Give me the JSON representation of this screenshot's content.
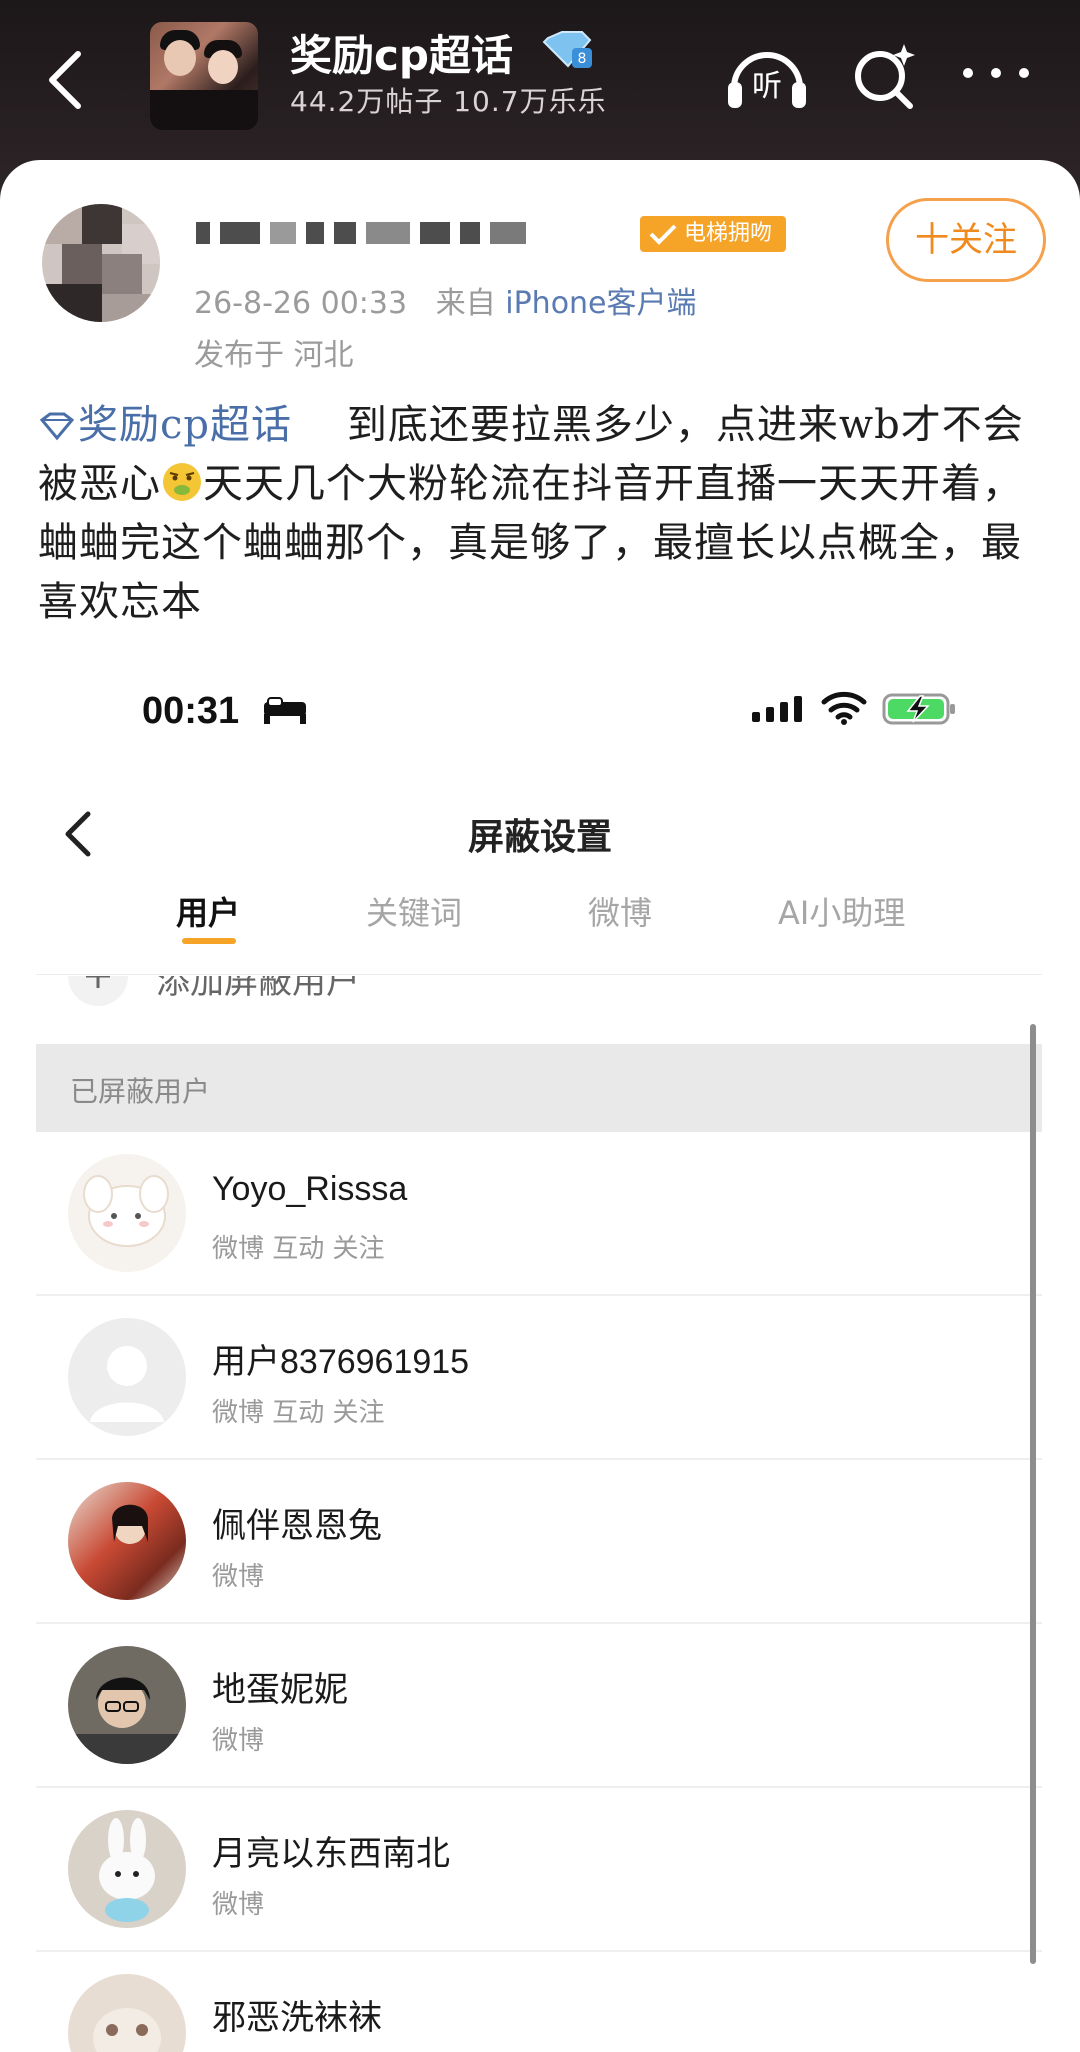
{
  "header": {
    "topic_title": "奖励cp超话",
    "topic_stats": "44.2万帖子 10.7万乐乐",
    "listen_label": "听"
  },
  "post": {
    "elevator_tag": "电梯拥吻",
    "follow_label": "十关注",
    "meta_time": "26-8-26 00:33",
    "meta_from": "来自",
    "meta_source": "iPhone客户端",
    "location": "发布于 河北",
    "topic_link": "奖励cp超话",
    "text_part1": "到底还要拉黑多少，点进来wb才不会被恶心",
    "text_part2": "天天几个大粉轮流在抖音开直播一天天开着，蛐蛐完这个蛐蛐那个，真是够了，最擅长以点概全，最喜欢忘本"
  },
  "embedded": {
    "status_time": "00:31",
    "nav_title": "屏蔽设置",
    "tabs": [
      "用户",
      "关键词",
      "微博",
      "AI小助理"
    ],
    "add_label": "添加屏蔽用户",
    "section_header": "已屏蔽用户",
    "users": [
      {
        "name": "Yoyo_Risssa",
        "tags": "微博 互动 关注"
      },
      {
        "name": "用户8376961915",
        "tags": "微博 互动 关注"
      },
      {
        "name": "佩伴恩恩兔",
        "tags": "微博"
      },
      {
        "name": "地蛋妮妮",
        "tags": "微博"
      },
      {
        "name": "月亮以东西南北",
        "tags": "微博"
      },
      {
        "name": "邪恶洗袜袜",
        "tags": ""
      }
    ]
  },
  "colors": {
    "accent_orange": "#f5a428",
    "link_blue": "#4a6fa8",
    "follow_orange": "#f08a1e"
  },
  "icons": [
    "back-arrow-icon",
    "verified-diamond-icon",
    "headphones-icon",
    "search-sparkle-icon",
    "more-dots-icon",
    "checkmark-icon",
    "nauseated-emoji-icon",
    "bed-icon",
    "signal-icon",
    "wifi-icon",
    "battery-charging-icon",
    "plus-icon"
  ]
}
